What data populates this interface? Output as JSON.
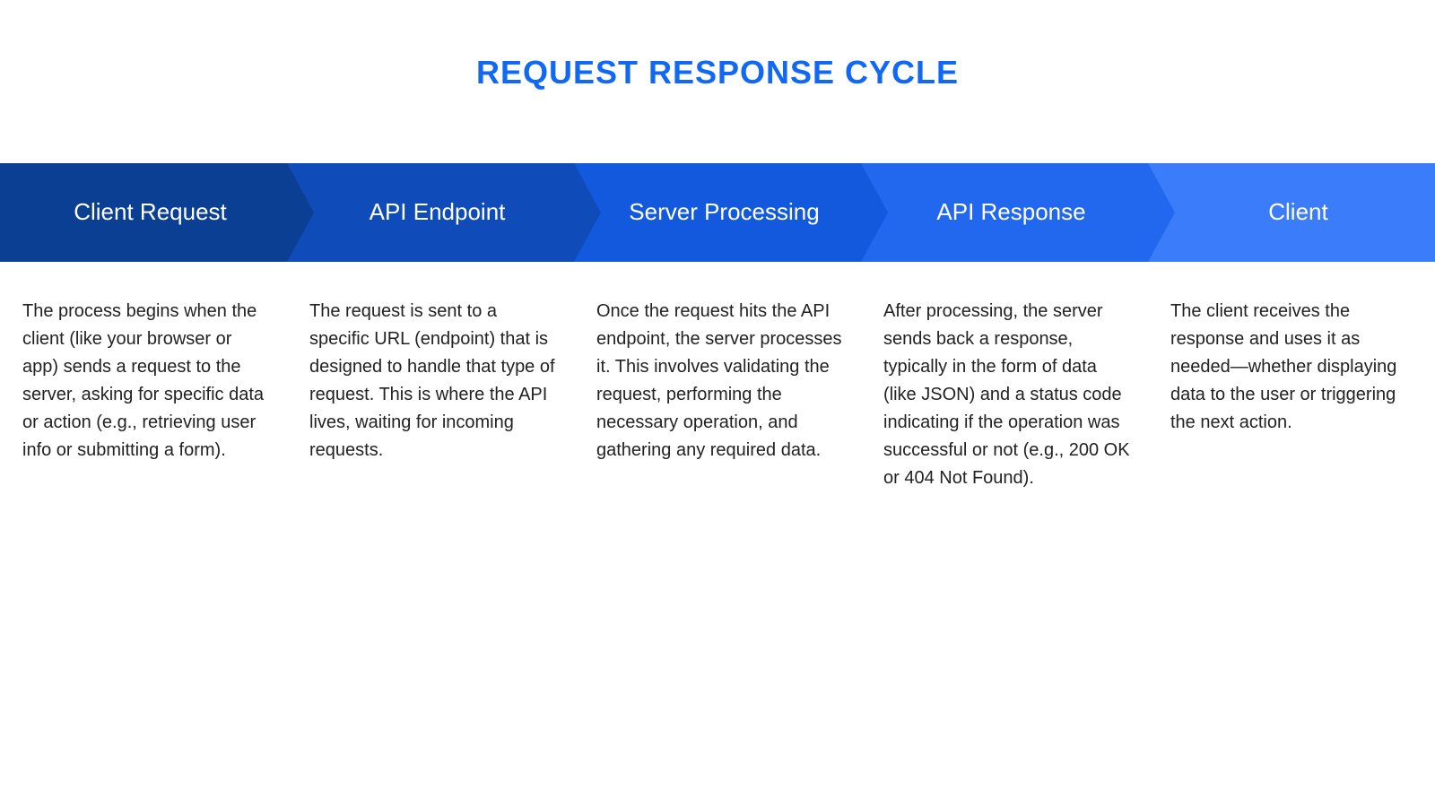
{
  "title": "REQUEST RESPONSE CYCLE",
  "steps": [
    {
      "label": "Client Request",
      "description": "The process begins when the client (like your browser or app) sends a request to the server, asking for specific data or action (e.g., retrieving user info or submitting a form).",
      "color": "#0b3f94"
    },
    {
      "label": "API Endpoint",
      "description": "The request is sent to a specific URL (endpoint) that is designed to handle that type of request. This is where the API lives, waiting for incoming requests.",
      "color": "#0f4cba"
    },
    {
      "label": "Server Processing",
      "description": "Once the request hits the API endpoint, the server processes it. This involves validating the request, performing the necessary operation, and gathering any required data.",
      "color": "#1359de"
    },
    {
      "label": "API Response",
      "description": " After processing, the server sends back a response, typically in the form of data (like JSON) and a status code indicating if the operation was successful or not (e.g., 200 OK or 404 Not Found).",
      "color": "#2168ef"
    },
    {
      "label": "Client",
      "description": "The client receives the response and uses it as needed—whether displaying data to the user or triggering the next action.",
      "color": "#3a7cfa"
    }
  ]
}
